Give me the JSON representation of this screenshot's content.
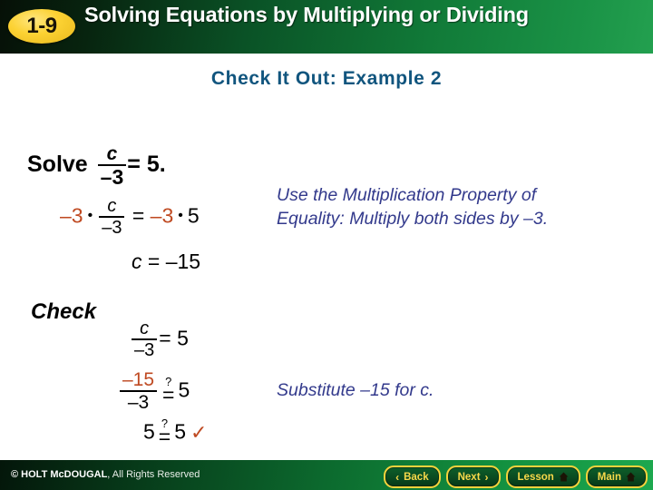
{
  "header": {
    "badge_label": "1-9",
    "title": "Solving Equations by Multiplying or Dividing",
    "gradient_from": "#061007",
    "gradient_to": "#23a04f",
    "badge_color": "#fcd233"
  },
  "subtitle": "Check It Out: Example 2",
  "colors": {
    "accent_rust": "#bf4a22",
    "note_navy": "#333a8c",
    "subtitle_blue": "#11557e",
    "button_gold": "#f5d33c"
  },
  "work": {
    "solve": {
      "label": "Solve",
      "numerator": "c",
      "denominator": "–3",
      "equals": "=",
      "right": "5."
    },
    "multiply": {
      "left_factor": "–3",
      "dot": "•",
      "numerator": "c",
      "denominator": "–3",
      "equals": "=",
      "right_factor": "–3",
      "right_dot": "•",
      "right_value": "5"
    },
    "result": {
      "variable": "c",
      "equals": "=",
      "value": "–15"
    },
    "note_multiplication": "Use the Multiplication Property of Equality: Multiply both sides by –3."
  },
  "check": {
    "heading": "Check",
    "line1": {
      "numerator": "c",
      "denominator": "–3",
      "equals": "=",
      "right": "5"
    },
    "line2": {
      "numerator": "–15",
      "denominator": "–3",
      "question": "?",
      "equals": "=",
      "right": "5"
    },
    "line3": {
      "left": "5",
      "question": "?",
      "equals": "=",
      "right": "5",
      "checkmark": "✓"
    },
    "note_substitute": "Substitute –15 for c."
  },
  "footer": {
    "copyright_strong": "© HOLT McDOUGAL",
    "copyright_rest": ", All Rights Reserved",
    "buttons": [
      {
        "label": "Back",
        "chevron": "‹",
        "chevron_side": "left",
        "icon": null
      },
      {
        "label": "Next",
        "chevron": "›",
        "chevron_side": "right",
        "icon": null
      },
      {
        "label": "Lesson",
        "chevron": null,
        "chevron_side": null,
        "icon": "home-icon"
      },
      {
        "label": "Main",
        "chevron": null,
        "chevron_side": null,
        "icon": "home-icon"
      }
    ]
  }
}
